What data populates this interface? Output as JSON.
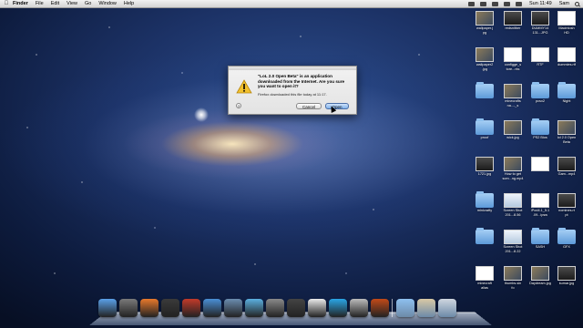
{
  "menubar": {
    "apple": "",
    "items": [
      "Finder",
      "File",
      "Edit",
      "View",
      "Go",
      "Window",
      "Help"
    ],
    "clock": "Sun 11:49",
    "user": "Sam"
  },
  "dialog": {
    "message": "\"LoL 2.0 Open Beta\" is an application downloaded from the Internet. Are you sure you want to open it?",
    "subtext": "Firefox downloaded this file today at 11:17.",
    "help": "?",
    "cancel": "Cancel",
    "open": "Open"
  },
  "desktop_icons": [
    {
      "label": "wallpaper.j\npg",
      "kind": "photo"
    },
    {
      "label": "redsnitber",
      "kind": "dark"
    },
    {
      "label": "DUMMY14\n131...JPG",
      "kind": "dark"
    },
    {
      "label": "Macintosh\nHD",
      "kind": "doc"
    },
    {
      "label": "wallpaper2\n.jpg",
      "kind": "photo"
    },
    {
      "label": "configge_s\ntore...nts",
      "kind": "doc"
    },
    {
      "label": "RTF",
      "kind": "doc"
    },
    {
      "label": "dummies.rtf",
      "kind": "doc"
    },
    {
      "label": "",
      "kind": "folder"
    },
    {
      "label": "minecrafts\nna...-_s",
      "kind": "photo"
    },
    {
      "label": "pcsx2",
      "kind": "folder"
    },
    {
      "label": "Night",
      "kind": "folder"
    },
    {
      "label": "proof",
      "kind": "folder"
    },
    {
      "label": "wick.jpg",
      "kind": "photo"
    },
    {
      "label": "PS2 Bios",
      "kind": "folder"
    },
    {
      "label": "lol 2.0 Open\nBeta",
      "kind": "photo"
    },
    {
      "label": "1721.jpg",
      "kind": "dark"
    },
    {
      "label": "How to get\nsom...ng.mp4",
      "kind": "photo"
    },
    {
      "label": "",
      "kind": "doc"
    },
    {
      "label": "Gam...mp4",
      "kind": "dark"
    },
    {
      "label": "minicrafty",
      "kind": "folder"
    },
    {
      "label": "Screen Shot\n201...8.56",
      "kind": "screen"
    },
    {
      "label": "iPod4.1_5.1\n.09...ipsw",
      "kind": "doc"
    },
    {
      "label": "nomines.rt\npt",
      "kind": "dark"
    },
    {
      "label": "",
      "kind": "folder"
    },
    {
      "label": "Screen Shot\n201...8.22",
      "kind": "screen"
    },
    {
      "label": "SASH",
      "kind": "folder"
    },
    {
      "label": "GFX",
      "kind": "folder"
    },
    {
      "label": "minecraft\nalias",
      "kind": "doc"
    },
    {
      "label": "thumbs.sin\nfo",
      "kind": "photo"
    },
    {
      "label": "Daydream.jpg",
      "kind": "photo"
    },
    {
      "label": "kumar.jpg",
      "kind": "dark"
    }
  ],
  "dock": {
    "items": [
      "finder-icon",
      "launchpad-icon",
      "firefox-icon",
      "mission-control-icon",
      "photo-booth-icon",
      "dashboard-icon",
      "preview-icon",
      "itunes-icon",
      "system-preferences-icon",
      "movie-icon",
      "textedit-icon",
      "skype-icon",
      "utility-icon",
      "app-icon"
    ],
    "stacks": [
      "downloads-stack-icon",
      "documents-stack-icon",
      "trash-icon"
    ]
  }
}
